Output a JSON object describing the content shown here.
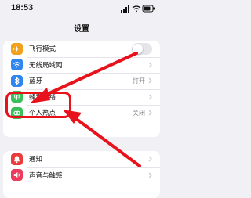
{
  "status_bar": {
    "time": "18:53",
    "icons": [
      "cellular-signal-icon",
      "wifi-icon",
      "battery-icon"
    ]
  },
  "header": {
    "title": "设置"
  },
  "settings": {
    "group1": [
      {
        "label": "飞行模式",
        "icon": "airplane-icon",
        "icon_color": "#f0a21c",
        "toggle": "off"
      },
      {
        "label": "无线局域网",
        "icon": "wifi-icon",
        "icon_color": "#2f86f0"
      },
      {
        "label": "蓝牙",
        "icon": "bluetooth-icon",
        "icon_color": "#2f86f0",
        "value": "打开"
      },
      {
        "label": "蜂窝网络",
        "icon": "cellular-antenna-icon",
        "icon_color": "#39c05a"
      },
      {
        "label": "个人热点",
        "icon": "hotspot-icon",
        "icon_color": "#39c05a",
        "value": "关闭"
      }
    ],
    "group2": [
      {
        "label": "通知",
        "icon": "bell-icon",
        "icon_color": "#ec3b3b"
      },
      {
        "label": "声音与触感",
        "icon": "speaker-icon",
        "icon_color": "#ec3b5c"
      }
    ]
  },
  "annotations": {
    "highlight_color": "#e8121c",
    "highlighted_item": "蜂窝网络"
  }
}
